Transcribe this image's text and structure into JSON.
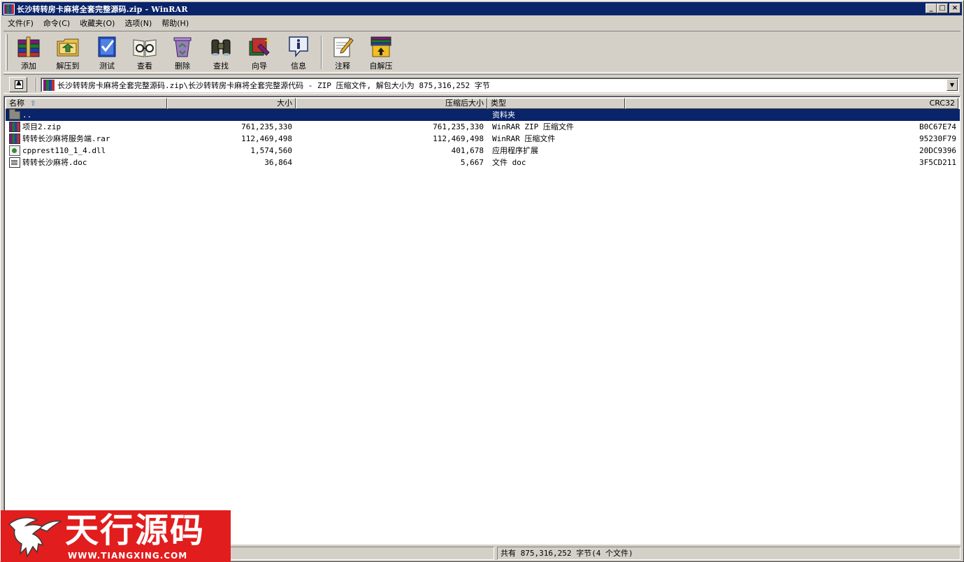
{
  "titlebar": {
    "title": "长沙转转房卡麻将全套完整源码.zip - WinRAR",
    "minimize": "_",
    "restore": "□",
    "close": "×"
  },
  "menu": [
    {
      "label": "文件(F)"
    },
    {
      "label": "命令(C)"
    },
    {
      "label": "收藏夹(O)"
    },
    {
      "label": "选项(N)"
    },
    {
      "label": "帮助(H)"
    }
  ],
  "toolbar": {
    "buttons": [
      {
        "label": "添加",
        "icon": "add-books-icon"
      },
      {
        "label": "解压到",
        "icon": "extract-folder-icon"
      },
      {
        "label": "测试",
        "icon": "test-check-icon"
      },
      {
        "label": "查看",
        "icon": "view-glasses-icon"
      },
      {
        "label": "删除",
        "icon": "delete-recycle-icon"
      },
      {
        "label": "查找",
        "icon": "find-binoculars-icon"
      },
      {
        "label": "向导",
        "icon": "wizard-icon"
      },
      {
        "label": "信息",
        "icon": "info-icon"
      },
      {
        "label": "注释",
        "icon": "comment-pen-icon"
      },
      {
        "label": "自解压",
        "icon": "sfx-box-icon"
      }
    ]
  },
  "address": {
    "path": "长沙转转房卡麻将全套完整源码.zip\\长沙转转房卡麻将全套完整源代码 - ZIP 压缩文件, 解包大小为 875,316,252 字节"
  },
  "columns": {
    "name": "名称",
    "size": "大小",
    "packed": "压缩后大小",
    "type": "类型",
    "crc": "CRC32"
  },
  "files": [
    {
      "name": "..",
      "size": "",
      "packed": "",
      "type": "资料夹",
      "crc": "",
      "icon": "folder"
    },
    {
      "name": "项目2.zip",
      "size": "761,235,330",
      "packed": "761,235,330",
      "type": "WinRAR ZIP 压缩文件",
      "crc": "B0C67E74",
      "icon": "rar"
    },
    {
      "name": "转转长沙麻将服务端.rar",
      "size": "112,469,498",
      "packed": "112,469,498",
      "type": "WinRAR 压缩文件",
      "crc": "95230F79",
      "icon": "rar"
    },
    {
      "name": "cpprest110_1_4.dll",
      "size": "1,574,560",
      "packed": "401,678",
      "type": "应用程序扩展",
      "crc": "20DC9396",
      "icon": "dll"
    },
    {
      "name": "转转长沙麻将.doc",
      "size": "36,864",
      "packed": "5,667",
      "type": "文件 doc",
      "crc": "3F5CD211",
      "icon": "doc"
    }
  ],
  "status": {
    "total": "共有 875,316,252 字节(4 个文件)"
  },
  "watermark": {
    "title": "天行源码",
    "url": "WWW.TIANGXING.COM"
  }
}
